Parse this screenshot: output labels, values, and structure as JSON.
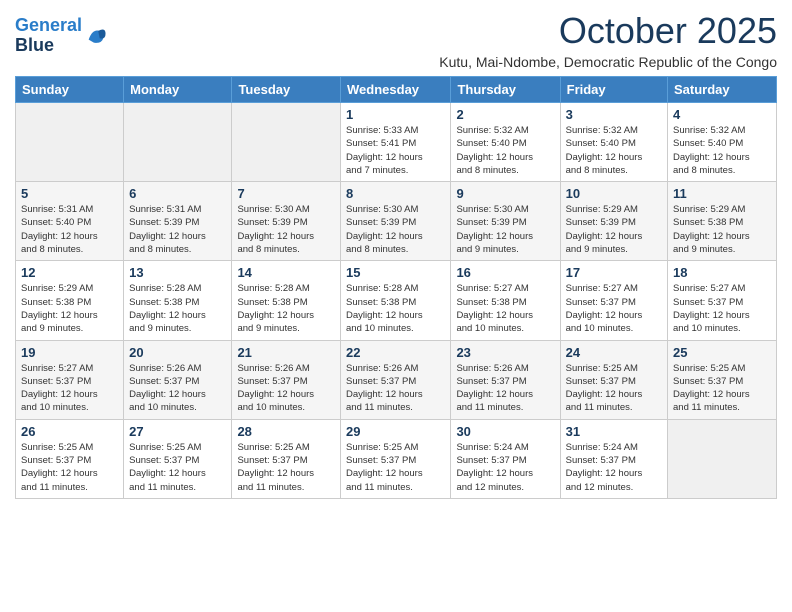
{
  "header": {
    "logo_line1": "General",
    "logo_line2": "Blue",
    "month": "October 2025",
    "location": "Kutu, Mai-Ndombe, Democratic Republic of the Congo"
  },
  "weekdays": [
    "Sunday",
    "Monday",
    "Tuesday",
    "Wednesday",
    "Thursday",
    "Friday",
    "Saturday"
  ],
  "weeks": [
    [
      {
        "day": "",
        "info": ""
      },
      {
        "day": "",
        "info": ""
      },
      {
        "day": "",
        "info": ""
      },
      {
        "day": "1",
        "info": "Sunrise: 5:33 AM\nSunset: 5:41 PM\nDaylight: 12 hours\nand 7 minutes."
      },
      {
        "day": "2",
        "info": "Sunrise: 5:32 AM\nSunset: 5:40 PM\nDaylight: 12 hours\nand 8 minutes."
      },
      {
        "day": "3",
        "info": "Sunrise: 5:32 AM\nSunset: 5:40 PM\nDaylight: 12 hours\nand 8 minutes."
      },
      {
        "day": "4",
        "info": "Sunrise: 5:32 AM\nSunset: 5:40 PM\nDaylight: 12 hours\nand 8 minutes."
      }
    ],
    [
      {
        "day": "5",
        "info": "Sunrise: 5:31 AM\nSunset: 5:40 PM\nDaylight: 12 hours\nand 8 minutes."
      },
      {
        "day": "6",
        "info": "Sunrise: 5:31 AM\nSunset: 5:39 PM\nDaylight: 12 hours\nand 8 minutes."
      },
      {
        "day": "7",
        "info": "Sunrise: 5:30 AM\nSunset: 5:39 PM\nDaylight: 12 hours\nand 8 minutes."
      },
      {
        "day": "8",
        "info": "Sunrise: 5:30 AM\nSunset: 5:39 PM\nDaylight: 12 hours\nand 8 minutes."
      },
      {
        "day": "9",
        "info": "Sunrise: 5:30 AM\nSunset: 5:39 PM\nDaylight: 12 hours\nand 9 minutes."
      },
      {
        "day": "10",
        "info": "Sunrise: 5:29 AM\nSunset: 5:39 PM\nDaylight: 12 hours\nand 9 minutes."
      },
      {
        "day": "11",
        "info": "Sunrise: 5:29 AM\nSunset: 5:38 PM\nDaylight: 12 hours\nand 9 minutes."
      }
    ],
    [
      {
        "day": "12",
        "info": "Sunrise: 5:29 AM\nSunset: 5:38 PM\nDaylight: 12 hours\nand 9 minutes."
      },
      {
        "day": "13",
        "info": "Sunrise: 5:28 AM\nSunset: 5:38 PM\nDaylight: 12 hours\nand 9 minutes."
      },
      {
        "day": "14",
        "info": "Sunrise: 5:28 AM\nSunset: 5:38 PM\nDaylight: 12 hours\nand 9 minutes."
      },
      {
        "day": "15",
        "info": "Sunrise: 5:28 AM\nSunset: 5:38 PM\nDaylight: 12 hours\nand 10 minutes."
      },
      {
        "day": "16",
        "info": "Sunrise: 5:27 AM\nSunset: 5:38 PM\nDaylight: 12 hours\nand 10 minutes."
      },
      {
        "day": "17",
        "info": "Sunrise: 5:27 AM\nSunset: 5:37 PM\nDaylight: 12 hours\nand 10 minutes."
      },
      {
        "day": "18",
        "info": "Sunrise: 5:27 AM\nSunset: 5:37 PM\nDaylight: 12 hours\nand 10 minutes."
      }
    ],
    [
      {
        "day": "19",
        "info": "Sunrise: 5:27 AM\nSunset: 5:37 PM\nDaylight: 12 hours\nand 10 minutes."
      },
      {
        "day": "20",
        "info": "Sunrise: 5:26 AM\nSunset: 5:37 PM\nDaylight: 12 hours\nand 10 minutes."
      },
      {
        "day": "21",
        "info": "Sunrise: 5:26 AM\nSunset: 5:37 PM\nDaylight: 12 hours\nand 10 minutes."
      },
      {
        "day": "22",
        "info": "Sunrise: 5:26 AM\nSunset: 5:37 PM\nDaylight: 12 hours\nand 11 minutes."
      },
      {
        "day": "23",
        "info": "Sunrise: 5:26 AM\nSunset: 5:37 PM\nDaylight: 12 hours\nand 11 minutes."
      },
      {
        "day": "24",
        "info": "Sunrise: 5:25 AM\nSunset: 5:37 PM\nDaylight: 12 hours\nand 11 minutes."
      },
      {
        "day": "25",
        "info": "Sunrise: 5:25 AM\nSunset: 5:37 PM\nDaylight: 12 hours\nand 11 minutes."
      }
    ],
    [
      {
        "day": "26",
        "info": "Sunrise: 5:25 AM\nSunset: 5:37 PM\nDaylight: 12 hours\nand 11 minutes."
      },
      {
        "day": "27",
        "info": "Sunrise: 5:25 AM\nSunset: 5:37 PM\nDaylight: 12 hours\nand 11 minutes."
      },
      {
        "day": "28",
        "info": "Sunrise: 5:25 AM\nSunset: 5:37 PM\nDaylight: 12 hours\nand 11 minutes."
      },
      {
        "day": "29",
        "info": "Sunrise: 5:25 AM\nSunset: 5:37 PM\nDaylight: 12 hours\nand 11 minutes."
      },
      {
        "day": "30",
        "info": "Sunrise: 5:24 AM\nSunset: 5:37 PM\nDaylight: 12 hours\nand 12 minutes."
      },
      {
        "day": "31",
        "info": "Sunrise: 5:24 AM\nSunset: 5:37 PM\nDaylight: 12 hours\nand 12 minutes."
      },
      {
        "day": "",
        "info": ""
      }
    ]
  ]
}
